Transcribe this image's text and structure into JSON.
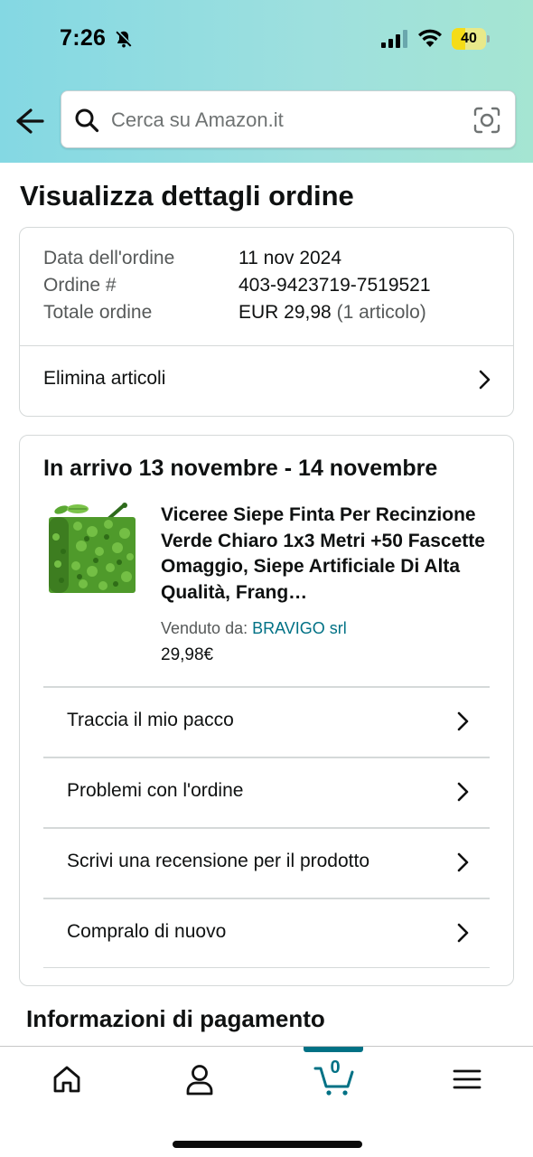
{
  "status_bar": {
    "time": "7:26",
    "battery_level": "40",
    "battery_fraction": 0.4
  },
  "search": {
    "placeholder": "Cerca su Amazon.it"
  },
  "page": {
    "title": "Visualizza dettagli ordine"
  },
  "order_summary": {
    "date_label": "Data dell'ordine",
    "date_value": "11 nov 2024",
    "number_label": "Ordine #",
    "number_value": "403-9423719-7519521",
    "total_label": "Totale ordine",
    "total_value": "EUR 29,98",
    "total_items": "(1 articolo)",
    "remove_items_label": "Elimina articoli"
  },
  "shipment": {
    "arrival": "In arrivo 13 novembre - 14 novembre",
    "product_title": "Viceree Siepe Finta Per Recinzione Verde Chiaro 1x3 Metri +50 Fascette Omaggio, Siepe Artificiale Di Alta Qualità, Frang…",
    "sold_by_label": "Venduto da: ",
    "seller": "BRAVIGO srl",
    "price": "29,98€",
    "actions": [
      {
        "label": "Traccia il mio pacco"
      },
      {
        "label": "Problemi con l'ordine"
      },
      {
        "label": "Scrivi una recensione per il prodotto"
      },
      {
        "label": "Compralo di nuovo"
      }
    ]
  },
  "payment": {
    "title": "Informazioni di pagamento"
  },
  "bottom_nav": {
    "cart_count": "0",
    "items": [
      "home-icon",
      "account-icon",
      "cart-icon",
      "menu-icon"
    ]
  },
  "colors": {
    "link": "#007185",
    "header_gradient_start": "#84d8e3",
    "header_gradient_end": "#a5e5d2",
    "battery": "#f5dc17"
  }
}
